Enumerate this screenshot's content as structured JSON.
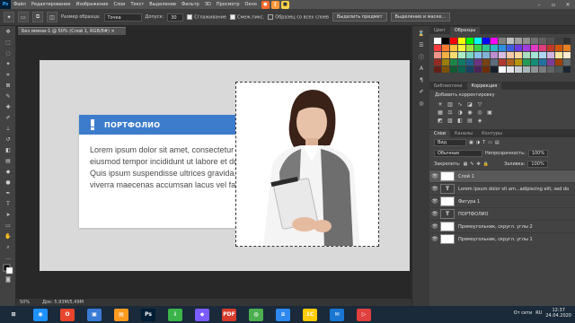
{
  "menu": {
    "logo": "Ps",
    "items": [
      "Файл",
      "Редактирование",
      "Изображение",
      "Слои",
      "Текст",
      "Выделение",
      "Фильтр",
      "3D",
      "Просмотр",
      "Окно"
    ],
    "rec_label": "●"
  },
  "options": {
    "sample_size_label": "Размер образца:",
    "sample_size_value": "Точка",
    "tolerance_label": "Допуск:",
    "tolerance_value": "30",
    "antialias_label": "Сглаживание",
    "contiguous_label": "Смеж.пикс.",
    "all_layers_label": "Образец со всех слоев",
    "select_subject_button": "Выделить предмет",
    "select_mask_button": "Выделение и маске..."
  },
  "document_tab": "Без имени-1 @ 50% (Слой 1, RGB/8#) ×",
  "canvas": {
    "card_title": "ПОРТФОЛИО",
    "card_lines": [
      "Lorem ipsum dolor sit amet, consectetur adipisc",
      "eiusmod tempor incididunt ut labore et dolore",
      "Quis ipsum suspendisse ultrices gravida. Risus",
      "viverra maecenas accumsan lacus vel facilisis."
    ]
  },
  "status": {
    "zoom": "50%",
    "doc_info": "Док: 5,93М/5,49М"
  },
  "swatches_panel": {
    "tabs": [
      "Цвет",
      "Образцы"
    ],
    "active": "Образцы",
    "colors": [
      "#ffffff",
      "#000000",
      "#ff0000",
      "#ffff00",
      "#00ff00",
      "#00ffff",
      "#0000ff",
      "#ff00ff",
      "#808080",
      "#c0c0c0",
      "#a0a0a0",
      "#909090",
      "#707070",
      "#606060",
      "#505050",
      "#404040",
      "#303030",
      "#ff3b3b",
      "#ff7a2f",
      "#ffc43b",
      "#fff23b",
      "#a8e23b",
      "#3bd24a",
      "#2fc58f",
      "#2fb7c5",
      "#2f8fe0",
      "#3b5fe0",
      "#6a3be0",
      "#a43be0",
      "#e03bc4",
      "#e03b7a",
      "#c0392b",
      "#d35400",
      "#e67e22",
      "#f1948a",
      "#f5b041",
      "#f7dc6f",
      "#abebc6",
      "#76d7c4",
      "#85c1e9",
      "#7fb3d5",
      "#bb8fce",
      "#d7bde2",
      "#f5cba7",
      "#fad7a0",
      "#a9dfbf",
      "#a3e4d7",
      "#aed6f1",
      "#d2b4de",
      "#f9e79f",
      "#fdebd0",
      "#922b21",
      "#9a7d0a",
      "#1e8449",
      "#117a65",
      "#1f618d",
      "#6c3483",
      "#784212",
      "#5d6d7e",
      "#b03a2e",
      "#af601a",
      "#b7950b",
      "#239b56",
      "#148f77",
      "#2471a3",
      "#7d3c98",
      "#a04000",
      "#616a6b",
      "#641e16",
      "#7e5109",
      "#145a32",
      "#0e6251",
      "#154360",
      "#4a235a",
      "#6e2c00",
      "#17202a",
      "#ffffff",
      "#e5e7e9",
      "#cacfd2",
      "#aab7b8",
      "#909497",
      "#797d7f",
      "#626567",
      "#4d5656",
      "#1b2631"
    ]
  },
  "adjust_panel": {
    "tabs": [
      "Библиотеки",
      "Коррекция"
    ],
    "active": "Коррекция",
    "title": "Добавить корректировку"
  },
  "layers_panel": {
    "tabs": [
      "Слои",
      "Каналы",
      "Контуры"
    ],
    "active": "Слои",
    "kind_filter": "Вид",
    "blend_mode": "Обычные",
    "opacity_label": "Непрозрачность:",
    "opacity_value": "100%",
    "lock_label": "Закрепить:",
    "fill_label": "Заливка:",
    "fill_value": "100%",
    "layers": [
      {
        "name": "Слой 1",
        "thumb": "",
        "selected": true
      },
      {
        "name": "Lorem ipsum dolor sit am...adipiscing elit, sed do",
        "thumb": "T",
        "selected": false
      },
      {
        "name": "Фигура 1",
        "thumb": "",
        "selected": false
      },
      {
        "name": "ПОРТФОЛИО",
        "thumb": "T",
        "selected": false
      },
      {
        "name": "Прямоугольник, скругл. углы 2",
        "thumb": "",
        "selected": false
      },
      {
        "name": "Прямоугольник, скругл. углы 1",
        "thumb": "",
        "selected": false
      }
    ]
  },
  "taskbar": {
    "apps": [
      {
        "label": "◉",
        "color": "#1e90ff"
      },
      {
        "label": "O",
        "color": "#e8452c"
      },
      {
        "label": "▣",
        "color": "#3a7bd5"
      },
      {
        "label": "▤",
        "color": "#ff9a1f"
      },
      {
        "label": "Ps",
        "color": "#001e36"
      },
      {
        "label": "⇩",
        "color": "#3bb44a"
      },
      {
        "label": "◆",
        "color": "#7a5cff"
      },
      {
        "label": "PDF",
        "color": "#d83b2b"
      },
      {
        "label": "◍",
        "color": "#4caf50"
      },
      {
        "label": "≡",
        "color": "#2d89ef"
      },
      {
        "label": "1C",
        "color": "#ffcc00"
      },
      {
        "label": "✉",
        "color": "#1976d2"
      },
      {
        "label": "▷",
        "color": "#e04040"
      }
    ],
    "network": "От сети",
    "lang": "RU",
    "time": "12:37",
    "date": "24.04.2020"
  }
}
